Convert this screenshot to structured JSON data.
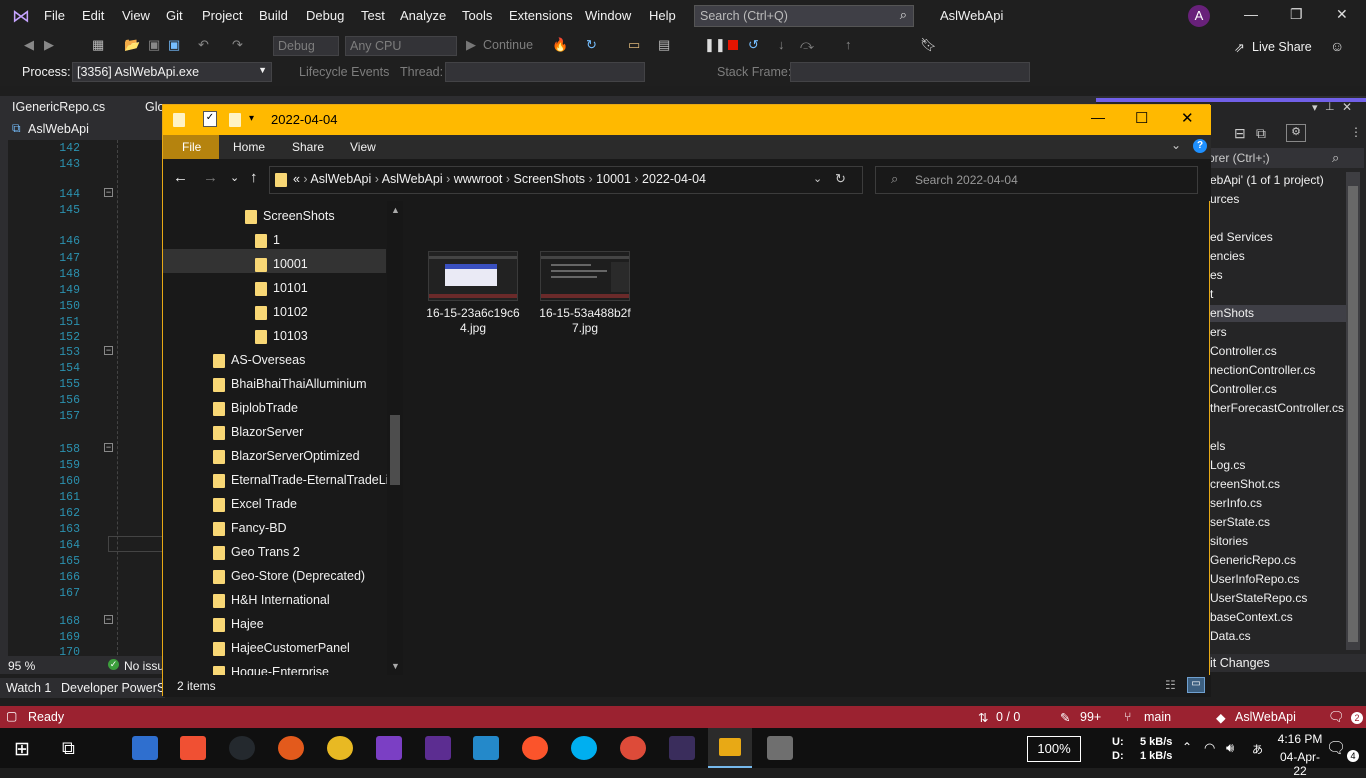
{
  "vs": {
    "menu": [
      "File",
      "Edit",
      "View",
      "Git",
      "Project",
      "Build",
      "Debug",
      "Test",
      "Analyze",
      "Tools",
      "Extensions",
      "Window",
      "Help"
    ],
    "search_placeholder": "Search (Ctrl+Q)",
    "app_title": "AslWebApi",
    "avatar_letter": "A",
    "config": "Debug",
    "platform": "Any CPU",
    "continue_label": "Continue",
    "live_share": "Live Share",
    "process_label": "Process:",
    "process_value": "[3356] AslWebApi.exe",
    "lifecycle_label": "Lifecycle Events",
    "thread_label": "Thread:",
    "stackframe_label": "Stack Frame:",
    "tabs": [
      "IGenericRepo.cs",
      "Glo"
    ],
    "project_tab": "AslWebApi",
    "line_numbers": [
      "142",
      "143",
      "144",
      "145",
      "146",
      "147",
      "148",
      "149",
      "150",
      "151",
      "152",
      "153",
      "154",
      "155",
      "156",
      "157",
      "158",
      "159",
      "160",
      "161",
      "162",
      "163",
      "164",
      "165",
      "166",
      "167",
      "168",
      "169",
      "170"
    ],
    "zoom": "95 %",
    "issues": "No issu",
    "bottom_tabs": [
      "Watch 1",
      "Developer PowerSh"
    ],
    "solution_explorer": {
      "search": "orer (Ctrl+;)",
      "items": [
        "ebApi' (1 of 1 project)",
        "urces",
        "",
        "ed Services",
        "encies",
        "es",
        "t",
        "enShots",
        "ers",
        "Controller.cs",
        "nectionController.cs",
        "Controller.cs",
        "therForecastController.cs",
        "",
        "els",
        "Log.cs",
        "creenShot.cs",
        "serInfo.cs",
        "serState.cs",
        "sitories",
        "GenericRepo.cs",
        "UserInfoRepo.cs",
        "UserStateRepo.cs",
        "baseContext.cs",
        "Data.cs"
      ],
      "git_changes": "it Changes"
    },
    "status": {
      "ready": "Ready",
      "updown": "0 / 0",
      "edits": "99+",
      "branch": "main",
      "repo": "AslWebApi",
      "notif": "2"
    }
  },
  "explorer": {
    "title": "2022-04-04",
    "ribbon_tabs": [
      "File",
      "Home",
      "Share",
      "View"
    ],
    "breadcrumb": [
      "«",
      "AslWebApi",
      "AslWebApi",
      "wwwroot",
      "ScreenShots",
      "10001",
      "2022-04-04"
    ],
    "search_placeholder": "Search 2022-04-04",
    "nav": [
      {
        "label": "ScreenShots",
        "level": 2
      },
      {
        "label": "1",
        "level": 3
      },
      {
        "label": "10001",
        "level": 3,
        "selected": true
      },
      {
        "label": "10101",
        "level": 3
      },
      {
        "label": "10102",
        "level": 3
      },
      {
        "label": "10103",
        "level": 3
      },
      {
        "label": "AS-Overseas",
        "level": 1
      },
      {
        "label": "BhaiBhaiThaiAlluminium",
        "level": 1
      },
      {
        "label": "BiplobTrade",
        "level": 1
      },
      {
        "label": "BlazorServer",
        "level": 1
      },
      {
        "label": "BlazorServerOptimized",
        "level": 1
      },
      {
        "label": "EternalTrade-EternalTradeLink",
        "level": 1
      },
      {
        "label": "Excel Trade",
        "level": 1
      },
      {
        "label": "Fancy-BD",
        "level": 1
      },
      {
        "label": "Geo Trans 2",
        "level": 1
      },
      {
        "label": "Geo-Store (Deprecated)",
        "level": 1
      },
      {
        "label": "H&H International",
        "level": 1
      },
      {
        "label": "Hajee",
        "level": 1
      },
      {
        "label": "HajeeCustomerPanel",
        "level": 1
      },
      {
        "label": "Hoque-Enterprise",
        "level": 1
      }
    ],
    "files": [
      {
        "line1": "16-15-23a6c19c6",
        "line2": "4.jpg"
      },
      {
        "line1": "16-15-53a488b2f",
        "line2": "7.jpg"
      }
    ],
    "item_count": "2 items"
  },
  "taskbar": {
    "zoom": "100%",
    "net_up_label": "U:",
    "net_up": "5 kB/s",
    "net_down_label": "D:",
    "net_down": "1 kB/s",
    "time": "4:16 PM",
    "date": "04-Apr-22",
    "notif_count": "4",
    "icon_colors": [
      "#2f6fcf",
      "#f05033",
      "#24292e",
      "#e35a1c",
      "#e8b923",
      "#7b3fc4",
      "#5c2d91",
      "#2489ca",
      "#fb542b",
      "#00aff0",
      "#dd4b39",
      "#3a2d5c",
      "#e8a915",
      "#6f6f6f"
    ]
  }
}
